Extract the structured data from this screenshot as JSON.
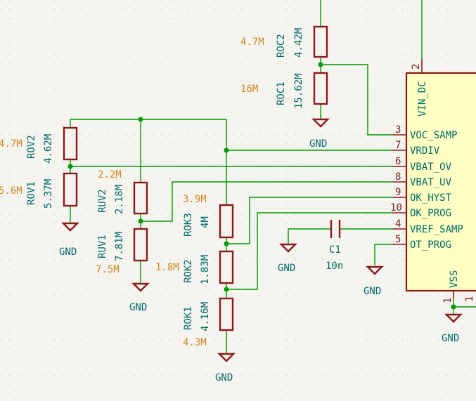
{
  "resistors": {
    "roc2": {
      "ref": "ROC2",
      "value": "4.42M",
      "note": "4.7M"
    },
    "roc1": {
      "ref": "ROC1",
      "value": "15.62M",
      "note": "16M"
    },
    "rov2": {
      "ref": "ROV2",
      "value": "4.62M",
      "note": "4.7M"
    },
    "rov1": {
      "ref": "ROV1",
      "value": "5.37M",
      "note": "5.6M"
    },
    "ruv2": {
      "ref": "RUV2",
      "value": "2.18M",
      "note": "2.2M"
    },
    "ruv1": {
      "ref": "RUV1",
      "value": "7.81M",
      "note": "7.5M"
    },
    "rok3": {
      "ref": "ROK3",
      "value": "4M",
      "note": "3.9M"
    },
    "rok2": {
      "ref": "ROK2",
      "value": "1.83M",
      "note": "1.8M"
    },
    "rok1": {
      "ref": "ROK1",
      "value": "4.16M",
      "note": "4.3M"
    }
  },
  "capacitor": {
    "ref": "C1",
    "value": "10n"
  },
  "gnd_label": "GND",
  "ic": {
    "pins": [
      {
        "num": "3",
        "name": "VOC_SAMP"
      },
      {
        "num": "7",
        "name": "VRDIV"
      },
      {
        "num": "6",
        "name": "VBAT_OV"
      },
      {
        "num": "8",
        "name": "VBAT_UV"
      },
      {
        "num": "9",
        "name": "OK_HYST"
      },
      {
        "num": "10",
        "name": "OK_PROG"
      },
      {
        "num": "4",
        "name": "VREF_SAMP"
      },
      {
        "num": "5",
        "name": "OT_PROG"
      }
    ],
    "top_pin": {
      "num": "2",
      "name": "VIN_DC"
    },
    "bottom_pin": {
      "num": "1",
      "name": "VSS"
    },
    "partial_pin_num": "1"
  },
  "colors": {
    "wire": "#009900",
    "component": "#8b1a1a",
    "label_teal": "#006b6b",
    "label_orange": "#d08a26",
    "ic_fill": "#ffffc3",
    "background": "#f5f4ef"
  }
}
